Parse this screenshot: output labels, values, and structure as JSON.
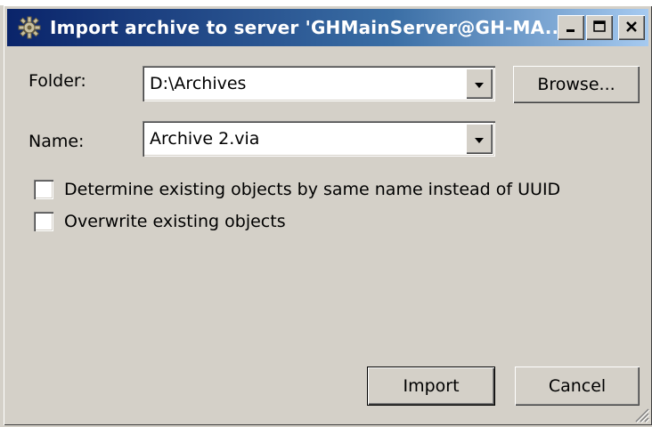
{
  "window": {
    "title": "Import archive to server 'GHMainServer@GH-MA...",
    "icon": "gear-icon",
    "controls": {
      "minimize": "minimize-icon",
      "maximize": "maximize-icon",
      "close": "close-icon"
    }
  },
  "form": {
    "folder": {
      "label": "Folder:",
      "value": "D:\\Archives",
      "browse_label": "Browse..."
    },
    "name": {
      "label": "Name:",
      "value": "Archive 2.via"
    },
    "options": [
      {
        "label": "Determine existing objects by same name instead of UUID",
        "checked": false
      },
      {
        "label": "Overwrite existing objects",
        "checked": false
      }
    ]
  },
  "actions": {
    "import_label": "Import",
    "cancel_label": "Cancel"
  },
  "colors": {
    "titlebar_start": "#0a246a",
    "titlebar_end": "#a6caf0",
    "face": "#d4d0c8"
  }
}
